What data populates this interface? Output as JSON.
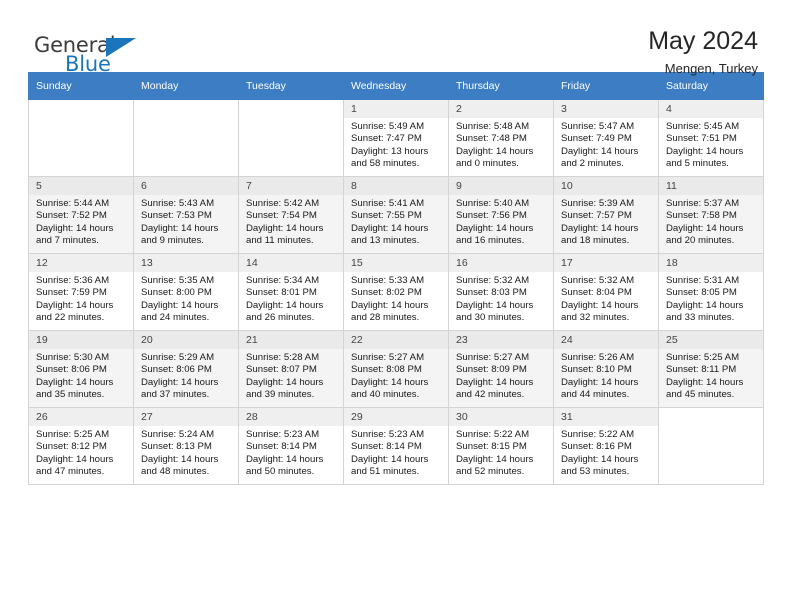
{
  "brand": {
    "name_top": "General",
    "name_bottom": "Blue",
    "flag_icon": "triangle-flag-icon",
    "accent_color": "#1b75bb"
  },
  "header": {
    "title": "May 2024",
    "subtitle": "Mengen, Turkey"
  },
  "calendar": {
    "header_bg": "#3c7dc4",
    "weekdays": [
      "Sunday",
      "Monday",
      "Tuesday",
      "Wednesday",
      "Thursday",
      "Friday",
      "Saturday"
    ],
    "weeks": [
      [
        {
          "day": "",
          "lines": []
        },
        {
          "day": "",
          "lines": []
        },
        {
          "day": "",
          "lines": []
        },
        {
          "day": "1",
          "lines": [
            "Sunrise: 5:49 AM",
            "Sunset: 7:47 PM",
            "Daylight: 13 hours",
            "and 58 minutes."
          ]
        },
        {
          "day": "2",
          "lines": [
            "Sunrise: 5:48 AM",
            "Sunset: 7:48 PM",
            "Daylight: 14 hours",
            "and 0 minutes."
          ]
        },
        {
          "day": "3",
          "lines": [
            "Sunrise: 5:47 AM",
            "Sunset: 7:49 PM",
            "Daylight: 14 hours",
            "and 2 minutes."
          ]
        },
        {
          "day": "4",
          "lines": [
            "Sunrise: 5:45 AM",
            "Sunset: 7:51 PM",
            "Daylight: 14 hours",
            "and 5 minutes."
          ]
        }
      ],
      [
        {
          "day": "5",
          "lines": [
            "Sunrise: 5:44 AM",
            "Sunset: 7:52 PM",
            "Daylight: 14 hours",
            "and 7 minutes."
          ]
        },
        {
          "day": "6",
          "lines": [
            "Sunrise: 5:43 AM",
            "Sunset: 7:53 PM",
            "Daylight: 14 hours",
            "and 9 minutes."
          ]
        },
        {
          "day": "7",
          "lines": [
            "Sunrise: 5:42 AM",
            "Sunset: 7:54 PM",
            "Daylight: 14 hours",
            "and 11 minutes."
          ]
        },
        {
          "day": "8",
          "lines": [
            "Sunrise: 5:41 AM",
            "Sunset: 7:55 PM",
            "Daylight: 14 hours",
            "and 13 minutes."
          ]
        },
        {
          "day": "9",
          "lines": [
            "Sunrise: 5:40 AM",
            "Sunset: 7:56 PM",
            "Daylight: 14 hours",
            "and 16 minutes."
          ]
        },
        {
          "day": "10",
          "lines": [
            "Sunrise: 5:39 AM",
            "Sunset: 7:57 PM",
            "Daylight: 14 hours",
            "and 18 minutes."
          ]
        },
        {
          "day": "11",
          "lines": [
            "Sunrise: 5:37 AM",
            "Sunset: 7:58 PM",
            "Daylight: 14 hours",
            "and 20 minutes."
          ]
        }
      ],
      [
        {
          "day": "12",
          "lines": [
            "Sunrise: 5:36 AM",
            "Sunset: 7:59 PM",
            "Daylight: 14 hours",
            "and 22 minutes."
          ]
        },
        {
          "day": "13",
          "lines": [
            "Sunrise: 5:35 AM",
            "Sunset: 8:00 PM",
            "Daylight: 14 hours",
            "and 24 minutes."
          ]
        },
        {
          "day": "14",
          "lines": [
            "Sunrise: 5:34 AM",
            "Sunset: 8:01 PM",
            "Daylight: 14 hours",
            "and 26 minutes."
          ]
        },
        {
          "day": "15",
          "lines": [
            "Sunrise: 5:33 AM",
            "Sunset: 8:02 PM",
            "Daylight: 14 hours",
            "and 28 minutes."
          ]
        },
        {
          "day": "16",
          "lines": [
            "Sunrise: 5:32 AM",
            "Sunset: 8:03 PM",
            "Daylight: 14 hours",
            "and 30 minutes."
          ]
        },
        {
          "day": "17",
          "lines": [
            "Sunrise: 5:32 AM",
            "Sunset: 8:04 PM",
            "Daylight: 14 hours",
            "and 32 minutes."
          ]
        },
        {
          "day": "18",
          "lines": [
            "Sunrise: 5:31 AM",
            "Sunset: 8:05 PM",
            "Daylight: 14 hours",
            "and 33 minutes."
          ]
        }
      ],
      [
        {
          "day": "19",
          "lines": [
            "Sunrise: 5:30 AM",
            "Sunset: 8:06 PM",
            "Daylight: 14 hours",
            "and 35 minutes."
          ]
        },
        {
          "day": "20",
          "lines": [
            "Sunrise: 5:29 AM",
            "Sunset: 8:06 PM",
            "Daylight: 14 hours",
            "and 37 minutes."
          ]
        },
        {
          "day": "21",
          "lines": [
            "Sunrise: 5:28 AM",
            "Sunset: 8:07 PM",
            "Daylight: 14 hours",
            "and 39 minutes."
          ]
        },
        {
          "day": "22",
          "lines": [
            "Sunrise: 5:27 AM",
            "Sunset: 8:08 PM",
            "Daylight: 14 hours",
            "and 40 minutes."
          ]
        },
        {
          "day": "23",
          "lines": [
            "Sunrise: 5:27 AM",
            "Sunset: 8:09 PM",
            "Daylight: 14 hours",
            "and 42 minutes."
          ]
        },
        {
          "day": "24",
          "lines": [
            "Sunrise: 5:26 AM",
            "Sunset: 8:10 PM",
            "Daylight: 14 hours",
            "and 44 minutes."
          ]
        },
        {
          "day": "25",
          "lines": [
            "Sunrise: 5:25 AM",
            "Sunset: 8:11 PM",
            "Daylight: 14 hours",
            "and 45 minutes."
          ]
        }
      ],
      [
        {
          "day": "26",
          "lines": [
            "Sunrise: 5:25 AM",
            "Sunset: 8:12 PM",
            "Daylight: 14 hours",
            "and 47 minutes."
          ]
        },
        {
          "day": "27",
          "lines": [
            "Sunrise: 5:24 AM",
            "Sunset: 8:13 PM",
            "Daylight: 14 hours",
            "and 48 minutes."
          ]
        },
        {
          "day": "28",
          "lines": [
            "Sunrise: 5:23 AM",
            "Sunset: 8:14 PM",
            "Daylight: 14 hours",
            "and 50 minutes."
          ]
        },
        {
          "day": "29",
          "lines": [
            "Sunrise: 5:23 AM",
            "Sunset: 8:14 PM",
            "Daylight: 14 hours",
            "and 51 minutes."
          ]
        },
        {
          "day": "30",
          "lines": [
            "Sunrise: 5:22 AM",
            "Sunset: 8:15 PM",
            "Daylight: 14 hours",
            "and 52 minutes."
          ]
        },
        {
          "day": "31",
          "lines": [
            "Sunrise: 5:22 AM",
            "Sunset: 8:16 PM",
            "Daylight: 14 hours",
            "and 53 minutes."
          ]
        },
        {
          "day": "",
          "lines": []
        }
      ]
    ]
  }
}
